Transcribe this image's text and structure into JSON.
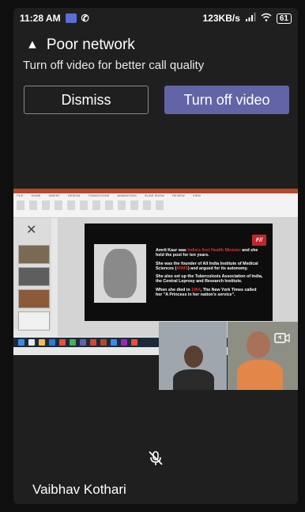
{
  "status_bar": {
    "time": "11:28 AM",
    "net_speed": "123KB/s",
    "battery": "61"
  },
  "banner": {
    "icon": "warning-icon",
    "title": "Poor network",
    "subtitle": "Turn off video for better call quality",
    "dismiss_label": "Dismiss",
    "turn_off_label": "Turn off video",
    "accent_color": "#6264a7"
  },
  "shared_screen": {
    "app": "PowerPoint",
    "slide": {
      "logo_text": "F//",
      "paragraph_1_a": "Amrit Kaur was ",
      "paragraph_1_b": "India's first Health Minister",
      "paragraph_1_c": " and she held the post for ten years.",
      "paragraph_2_a": "She was the founder of All India Institute of Medical Sciences (",
      "paragraph_2_b": "AIIMS",
      "paragraph_2_c": ") and argued for its autonomy.",
      "paragraph_3": "She also set up the Tuberculosis Association of India, the Central Leprosy and Research Institute.",
      "paragraph_4_a": "When she died in ",
      "paragraph_4_b": "1964",
      "paragraph_4_c": ", The New York Times called her \"A Princess in her nation's service\"."
    }
  },
  "call": {
    "participant_name": "Vaibhav Kothari",
    "mic_icon": "mic-off-icon",
    "switch_icon": "switch-camera-icon"
  }
}
